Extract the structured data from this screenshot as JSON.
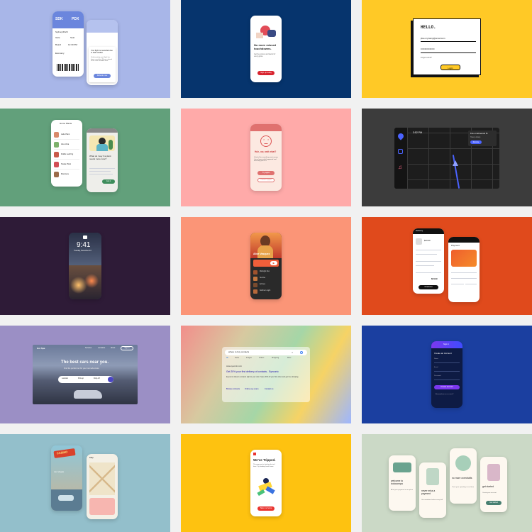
{
  "tiles": {
    "boarding": {
      "bg": "#a8b6e8",
      "accent": "#6b86dd",
      "from": "SDK",
      "to": "PDX",
      "city": "Sydney/Perth",
      "row1a": "Gate",
      "row1b": "Seat",
      "row2a": "Board",
      "row2b": "12:30 PM",
      "row3": "Economy",
      "popup_title": "Your flight is cancelled due to bad weather",
      "popup_body": "Unfortunately your flight has been cancelled. Please rebook at the next available time.",
      "popup_btn": "Rebook now"
    },
    "missed": {
      "bg": "#06346d",
      "accent": "#d8242f",
      "title": "No more missed touchdowns.",
      "body": "Get live scores and alerts for every game.",
      "btn": "Sign up today"
    },
    "hello": {
      "bg": "#ffc926",
      "accent": "#ffc926",
      "title": "HELLO.",
      "email": "jdoe.mycamp@email.com",
      "password": "••••••••••••••",
      "forgot": "Forgot a link?",
      "btn": "Login"
    },
    "plants": {
      "bg": "#62a07b",
      "accent": "#3e8d5c",
      "header": "Home Plants",
      "items": [
        "Jade Plant",
        "Aloe Vera",
        "Fiddle Leaf Fig",
        "Snake Plant",
        "Monstera"
      ],
      "popup_title": "What do I say if a plant needs more care?",
      "popup_btn": "Got it"
    },
    "oops": {
      "bg": "#ffaaa9",
      "accent": "#e0716f",
      "title": "Huh, ow, wait what?",
      "body": "It looks like something went wrong. Let us know what happened and we'll help you fix it.",
      "btn1": "Try again",
      "btn2": "Contact support"
    },
    "nav": {
      "bg": "#3c3c3c",
      "accent": "#4b63ff",
      "time": "3:52 PM",
      "card_title": "Fire on Elmwood St",
      "card_sub": "Heavy delays",
      "card_btn": "Reroute"
    },
    "lock": {
      "bg": "#2e1b37",
      "time": "9:41",
      "date": "Tuesday, December 24"
    },
    "music": {
      "bg": "#fb9577",
      "accent": "#ef5e3a",
      "artist": "Alice Vasquez",
      "tracks": [
        "Midnight Run",
        "Sunrise",
        "Echoes",
        "Northern Light"
      ]
    },
    "checkout": {
      "bg": "#e04a1c",
      "accent": "#ef5e2d",
      "title": "Delivery",
      "price": "$29.99",
      "total": "$34.99",
      "btn": "Checkout",
      "pay_title": "Payment"
    },
    "cars": {
      "bg": "#9b8fc5",
      "accent": "#4b46c4",
      "brand": "Hot Spa",
      "nav": [
        "Services",
        "Locations",
        "About"
      ],
      "nav_btn": "Sign in",
      "headline": "The best cars near you.",
      "sub": "Find the perfect car for your next adventure",
      "field1": "Location",
      "field2": "Pick-up",
      "field3": "Drop-off"
    },
    "search": {
      "query": "where to buy contacts",
      "tabs": [
        "All",
        "News",
        "Images",
        "Videos",
        "Shopping",
        "More"
      ],
      "url": "www.eyeconic.com",
      "headline": "Get 20% your first delivery of contacts - Eyeconic",
      "desc": "Eyeconic delivers contacts right to your door. Save 20% off your first order and get free shipping.",
      "links": [
        "Browse contacts",
        "Online eye exam",
        "Contact us"
      ]
    },
    "account": {
      "bg": "#1b3fa0",
      "accent": "#7b38ef",
      "header": "Sign in",
      "title": "Create an Account",
      "field1": "Name",
      "field2": "Email",
      "field3": "Password",
      "btn": "Create account",
      "footer": "Already have an account?"
    },
    "travel": {
      "bg": "#93bfcb",
      "sign": "CASINO",
      "place": "Las Vegas",
      "card_title": "Map"
    },
    "tripped": {
      "bg": "#fec210",
      "accent": "#e9332f",
      "title": "We've Tripped.",
      "body": "The page you're looking for isn't here. Try heading back home.",
      "btn": "Take me home"
    },
    "onboard": {
      "bg": "#cbd9c6",
      "accent": "#477f71",
      "screens": [
        {
          "title": "welcome to todocompa",
          "body": "All of your payment in one place"
        },
        {
          "title": "never miss a payment",
          "body": "Get reminders before every bill"
        },
        {
          "title": "no more overdrafts",
          "body": "Track your spending in real time"
        },
        {
          "title": "get started",
          "body": "Create your account",
          "btn": "Get started"
        }
      ]
    }
  }
}
